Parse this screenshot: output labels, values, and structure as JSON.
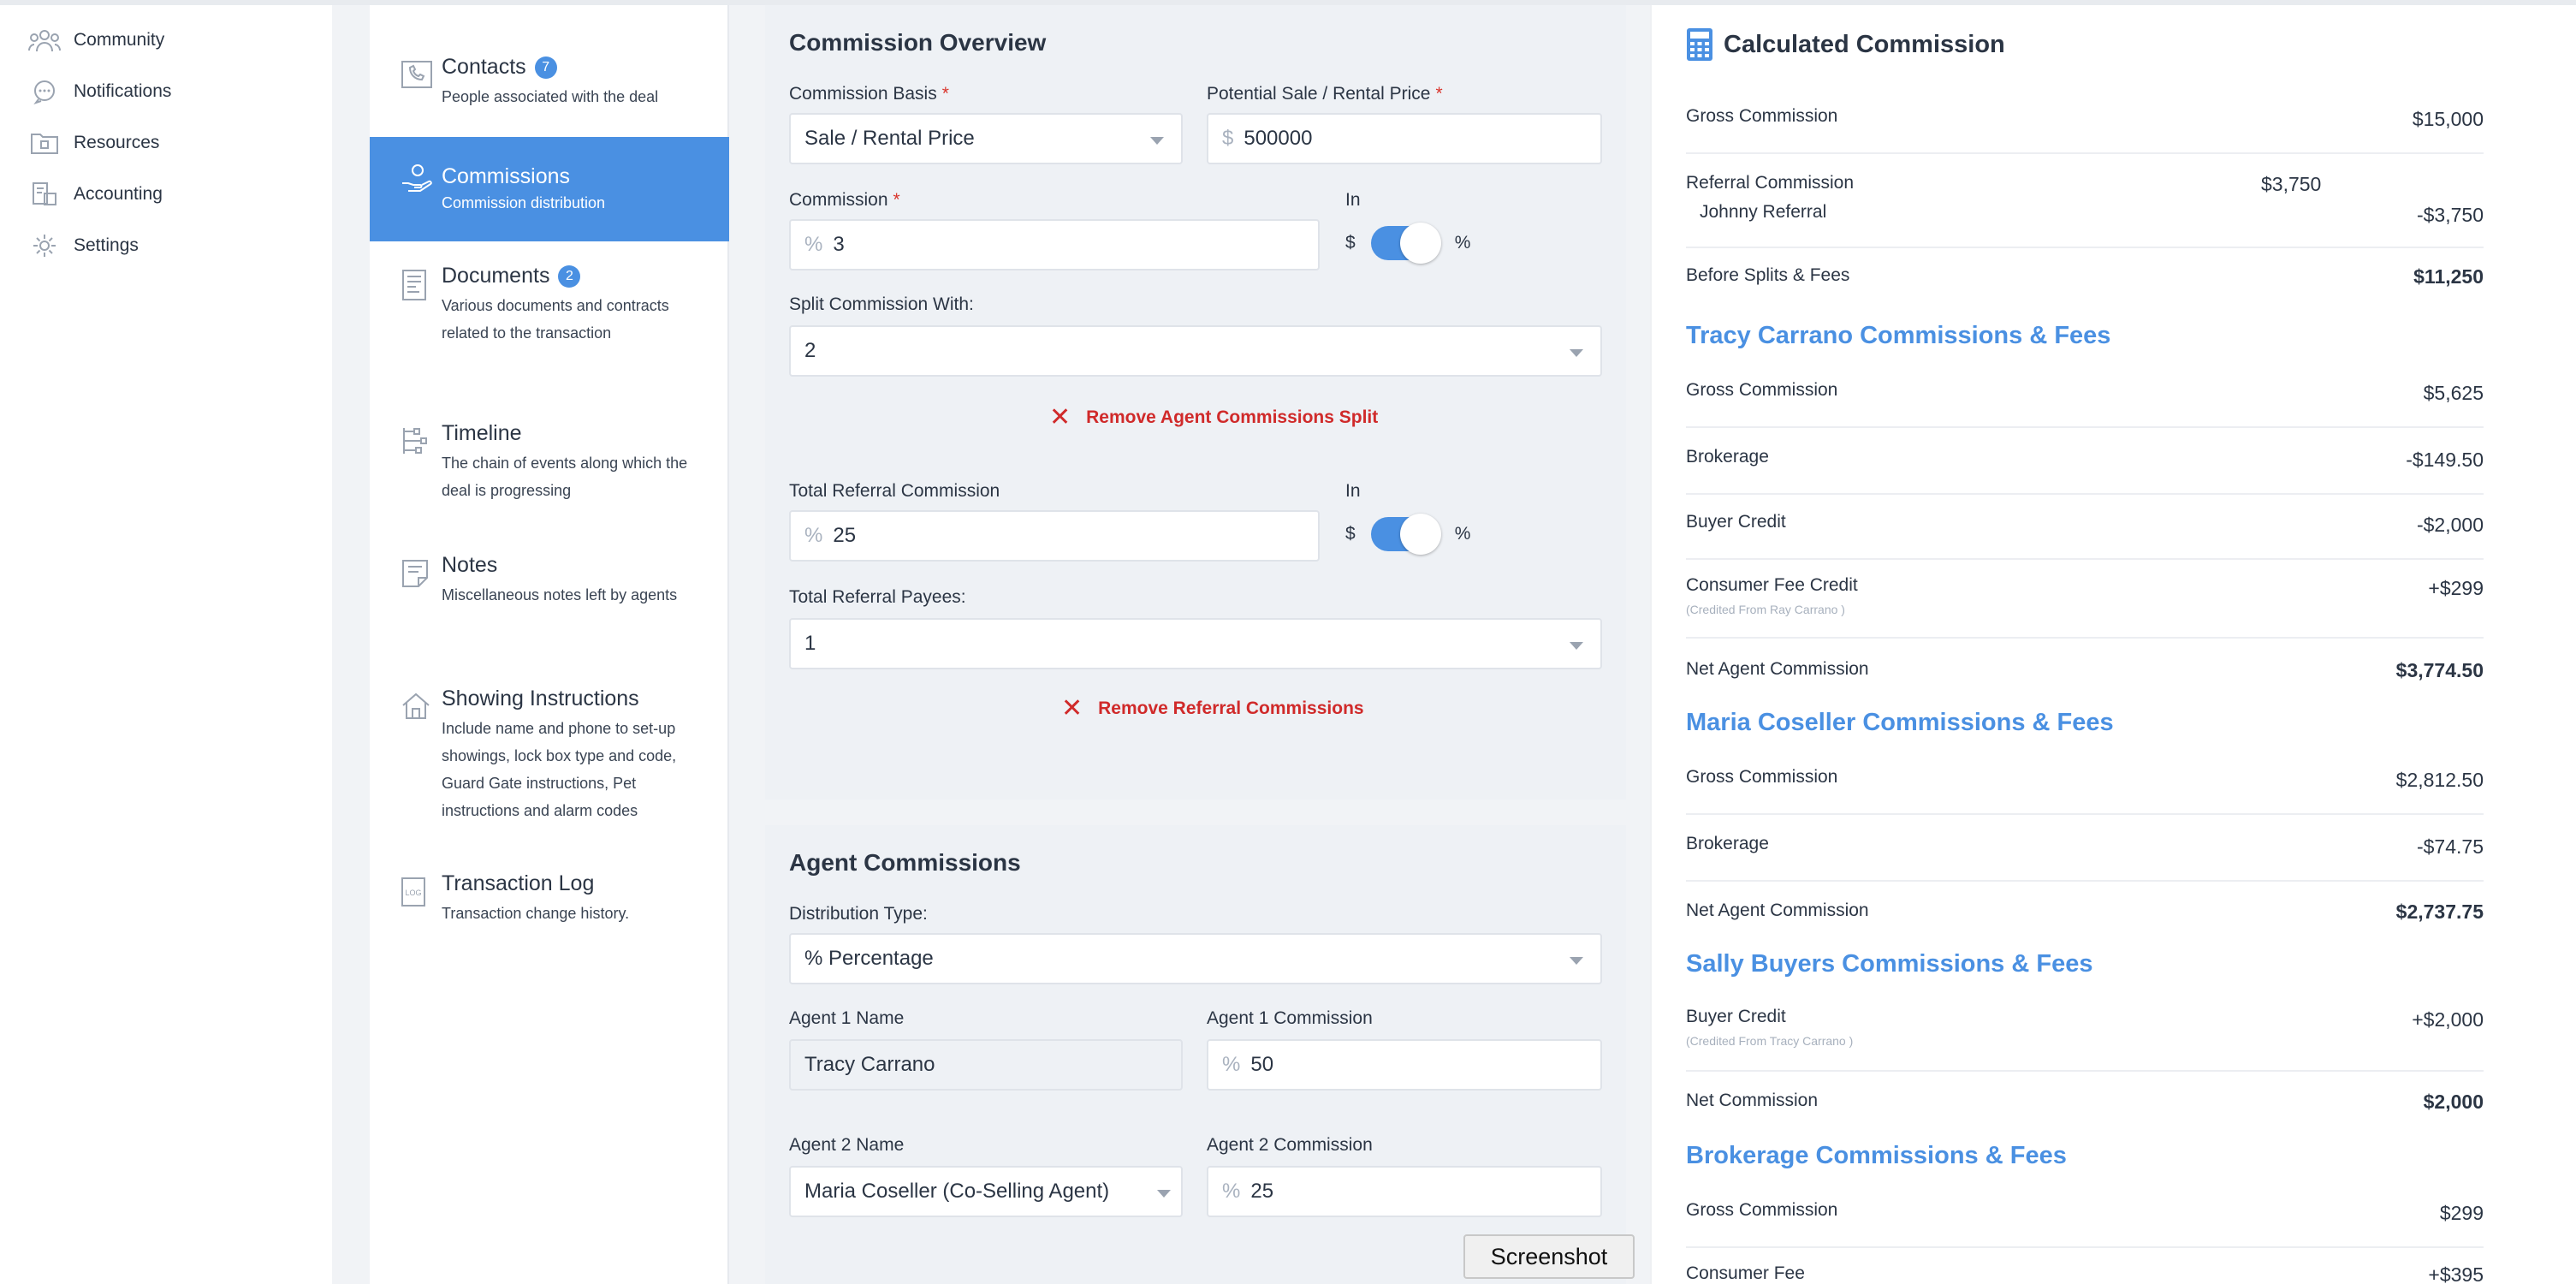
{
  "nav": {
    "items": [
      {
        "label": "Community",
        "icon": "community-icon"
      },
      {
        "label": "Notifications",
        "icon": "notifications-icon"
      },
      {
        "label": "Resources",
        "icon": "resources-icon"
      },
      {
        "label": "Accounting",
        "icon": "accounting-icon"
      },
      {
        "label": "Settings",
        "icon": "settings-icon"
      }
    ]
  },
  "subnav": {
    "items": [
      {
        "title": "Contacts",
        "badge": "7",
        "desc": "People associated with the deal"
      },
      {
        "title": "Commissions",
        "badge": "",
        "desc": "Commission distribution"
      },
      {
        "title": "Documents",
        "badge": "2",
        "desc": "Various documents and contracts related to the transaction"
      },
      {
        "title": "Timeline",
        "badge": "",
        "desc": "The chain of events along which the deal is progressing"
      },
      {
        "title": "Notes",
        "badge": "",
        "desc": "Miscellaneous notes left by agents"
      },
      {
        "title": "Showing Instructions",
        "badge": "",
        "desc": "Include name and phone to set-up showings, lock box type and code, Guard Gate instructions, Pet instructions and alarm codes"
      },
      {
        "title": "Transaction Log",
        "badge": "",
        "desc": "Transaction change history."
      }
    ]
  },
  "overview": {
    "title": "Commission Overview",
    "basis_label": "Commission Basis",
    "basis_value": "Sale / Rental Price",
    "price_label": "Potential Sale / Rental Price",
    "price_prefix": "$",
    "price_value": "500000",
    "commission_label": "Commission",
    "commission_prefix": "%",
    "commission_value": "3",
    "in_label": "In",
    "dollar": "$",
    "percent": "%",
    "split_label": "Split Commission With:",
    "split_value": "2",
    "remove_split": "Remove Agent Commissions Split",
    "referral_label": "Total Referral Commission",
    "referral_prefix": "%",
    "referral_value": "25",
    "payees_label": "Total Referral Payees:",
    "payees_value": "1",
    "remove_referral": "Remove Referral Commissions"
  },
  "agents": {
    "title": "Agent Commissions",
    "dist_label": "Distribution Type:",
    "dist_value": "% Percentage",
    "a1_name_label": "Agent 1 Name",
    "a1_name": "Tracy Carrano",
    "a1_comm_label": "Agent 1 Commission",
    "a1_prefix": "%",
    "a1_comm": "50",
    "a2_name_label": "Agent 2 Name",
    "a2_name": "Maria Coseller (Co-Selling Agent)",
    "a2_comm_label": "Agent 2 Commission",
    "a2_prefix": "%",
    "a2_comm": "25"
  },
  "calc": {
    "title": "Calculated Commission",
    "gross_label": "Gross Commission",
    "gross_value": "$15,000",
    "referral_label": "Referral Commission",
    "referral_mid": "$3,750",
    "referral_name": "Johnny Referral",
    "referral_value": "-$3,750",
    "before_label": "Before Splits & Fees",
    "before_value": "$11,250",
    "tracy": {
      "title": "Tracy Carrano Commissions & Fees",
      "gross_label": "Gross Commission",
      "gross_value": "$5,625",
      "brokerage_label": "Brokerage",
      "brokerage_value": "-$149.50",
      "buyer_label": "Buyer Credit",
      "buyer_value": "-$2,000",
      "consumer_label": "Consumer Fee Credit",
      "consumer_note": "(Credited From Ray Carrano )",
      "consumer_value": "+$299",
      "net_label": "Net Agent Commission",
      "net_value": "$3,774.50"
    },
    "maria": {
      "title": "Maria Coseller Commissions & Fees",
      "gross_label": "Gross Commission",
      "gross_value": "$2,812.50",
      "brokerage_label": "Brokerage",
      "brokerage_value": "-$74.75",
      "net_label": "Net Agent Commission",
      "net_value": "$2,737.75"
    },
    "sally": {
      "title": "Sally Buyers Commissions & Fees",
      "buyer_label": "Buyer Credit",
      "buyer_note": "(Credited From Tracy Carrano )",
      "buyer_value": "+$2,000",
      "net_label": "Net Commission",
      "net_value": "$2,000"
    },
    "brokerage": {
      "title": "Brokerage Commissions & Fees",
      "gross_label": "Gross Commission",
      "gross_value": "$299",
      "consumer_label": "Consumer Fee",
      "consumer_value": "+$395"
    }
  },
  "tooltip": "Screenshot",
  "colors": {
    "accent": "#4a90e2",
    "danger": "#d02a2a"
  }
}
